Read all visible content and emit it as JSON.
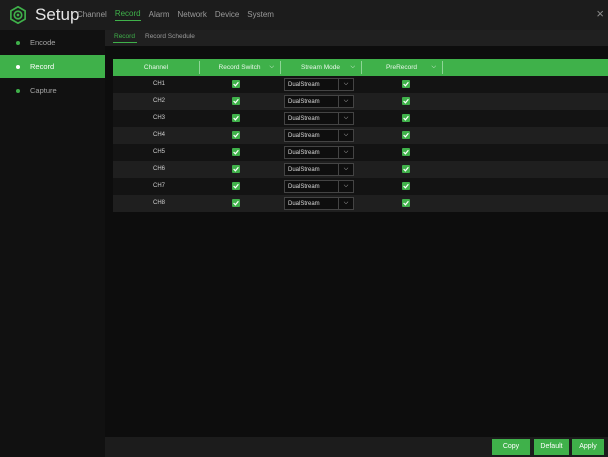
{
  "app": {
    "title": "Setup",
    "close_glyph": "×"
  },
  "menu": [
    {
      "label": "Channel",
      "active": false
    },
    {
      "label": "Record",
      "active": true
    },
    {
      "label": "Alarm",
      "active": false
    },
    {
      "label": "Network",
      "active": false
    },
    {
      "label": "Device",
      "active": false
    },
    {
      "label": "System",
      "active": false
    }
  ],
  "sidebar": [
    {
      "label": "Encode",
      "active": false
    },
    {
      "label": "Record",
      "active": true
    },
    {
      "label": "Capture",
      "active": false
    }
  ],
  "subtabs": [
    {
      "label": "Record",
      "active": true
    },
    {
      "label": "Record Schedule",
      "active": false
    }
  ],
  "table": {
    "headers": [
      "Channel",
      "Record Switch",
      "Stream Mode",
      "PreRecord"
    ],
    "rows": [
      {
        "channel": "CH1",
        "record_switch": true,
        "stream_mode": "DualStream",
        "prerecord": true
      },
      {
        "channel": "CH2",
        "record_switch": true,
        "stream_mode": "DualStream",
        "prerecord": true
      },
      {
        "channel": "CH3",
        "record_switch": true,
        "stream_mode": "DualStream",
        "prerecord": true
      },
      {
        "channel": "CH4",
        "record_switch": true,
        "stream_mode": "DualStream",
        "prerecord": true
      },
      {
        "channel": "CH5",
        "record_switch": true,
        "stream_mode": "DualStream",
        "prerecord": true
      },
      {
        "channel": "CH6",
        "record_switch": true,
        "stream_mode": "DualStream",
        "prerecord": true
      },
      {
        "channel": "CH7",
        "record_switch": true,
        "stream_mode": "DualStream",
        "prerecord": true
      },
      {
        "channel": "CH8",
        "record_switch": true,
        "stream_mode": "DualStream",
        "prerecord": true
      }
    ]
  },
  "footer": {
    "copy_label": "Copy",
    "default_label": "Default",
    "apply_label": "Apply"
  },
  "colors": {
    "accent": "#3fb14a",
    "background": "#0b0b0b",
    "panel": "#1c1c1c"
  },
  "icons": {
    "logo": "gear-icon",
    "close": "close-icon",
    "dropdown": "chevron-down-icon",
    "checkbox": "checkmark-icon"
  }
}
